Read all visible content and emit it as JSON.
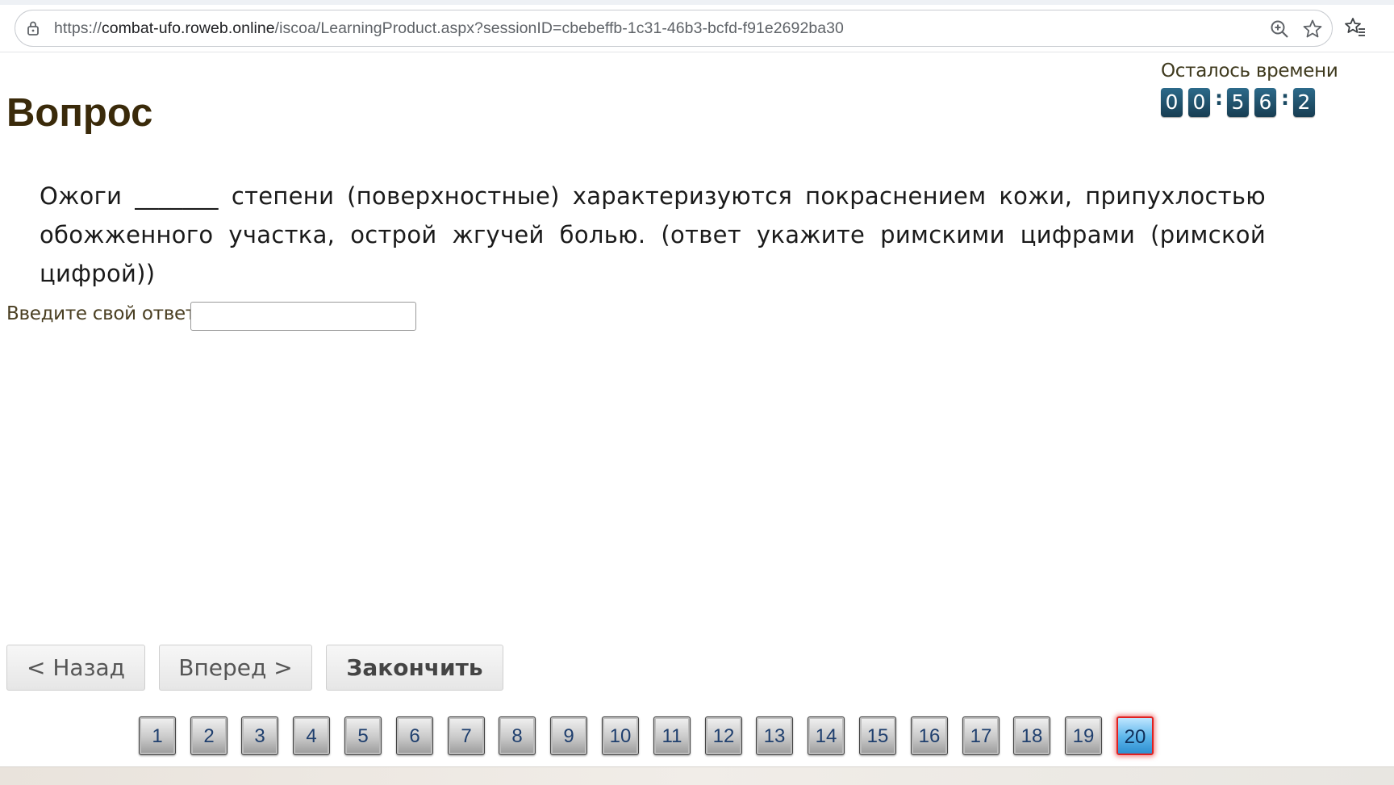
{
  "browser": {
    "url_prefix": "https://",
    "url_host": "combat-ufo.roweb.online",
    "url_path": "/iscoa/LearningProduct.aspx?sessionID=cbebeffb-1c31-46b3-bcfd-f91e2692ba30"
  },
  "page": {
    "heading": "Вопрос",
    "timer": {
      "label": "Осталось времени",
      "digits": [
        "0",
        "0",
        "5",
        "6",
        "2"
      ],
      "separator": ":"
    },
    "question": "Ожоги _______ степени (поверхностные) характеризуются покраснением кожи, припухлостью обожженного участка, острой жгучей болью. (ответ укажите римскими цифрами (римской цифрой))",
    "answer": {
      "label": "Введите свой ответ",
      "value": ""
    }
  },
  "nav": {
    "back_label": "< Назад",
    "next_label": "Вперед >",
    "finish_label": "Закончить"
  },
  "pagination": {
    "pages": [
      "1",
      "2",
      "3",
      "4",
      "5",
      "6",
      "7",
      "8",
      "9",
      "10",
      "11",
      "12",
      "13",
      "14",
      "15",
      "16",
      "17",
      "18",
      "19",
      "20"
    ],
    "current": "20"
  },
  "colors": {
    "timer_digit_bg": "#1f4f69",
    "heading": "#3a2a0a",
    "active_page_border": "#e02020",
    "active_page_bg": "#5ab4ea"
  }
}
